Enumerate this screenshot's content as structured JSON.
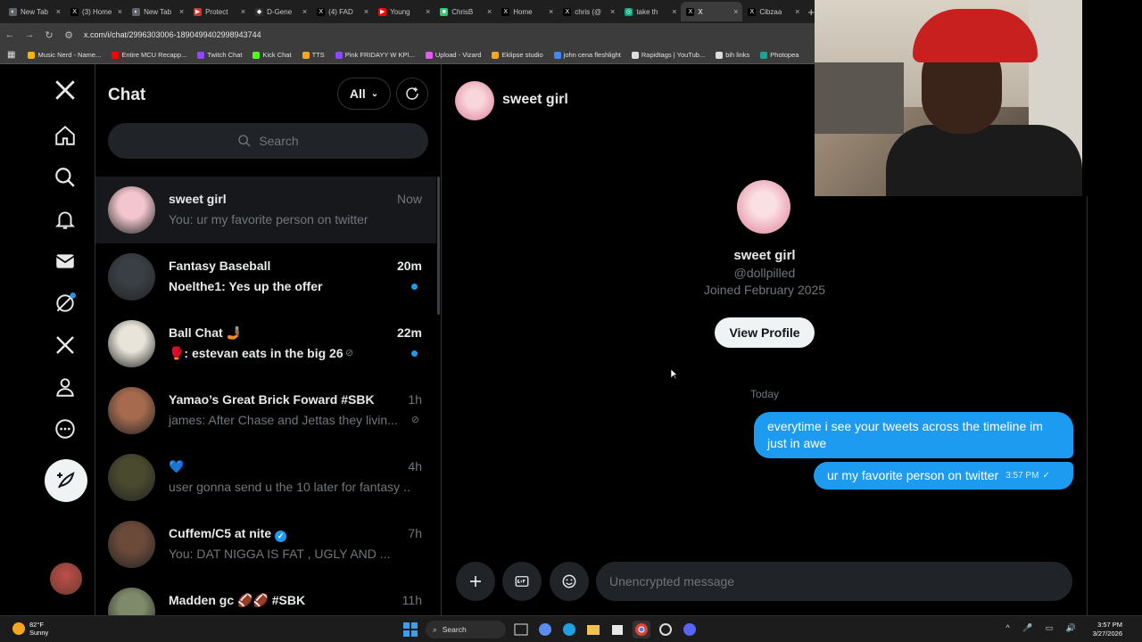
{
  "browser": {
    "tabs": [
      {
        "title": "New Tab",
        "color": "#5f6368",
        "glyph": "◐"
      },
      {
        "title": "(3) Home",
        "color": "#000000",
        "glyph": "X"
      },
      {
        "title": "New Tab",
        "color": "#5f6368",
        "glyph": "◐"
      },
      {
        "title": "Protect",
        "color": "#d93025",
        "glyph": "▶"
      },
      {
        "title": "D-Gene",
        "color": "#333333",
        "glyph": "◆"
      },
      {
        "title": "(4) FAD",
        "color": "#000000",
        "glyph": "X"
      },
      {
        "title": "Young",
        "color": "#ff0000",
        "glyph": "▶"
      },
      {
        "title": "ChrisB",
        "color": "#2ecc71",
        "glyph": "■"
      },
      {
        "title": "Home",
        "color": "#000000",
        "glyph": "X"
      },
      {
        "title": "chris (@",
        "color": "#000000",
        "glyph": "X"
      },
      {
        "title": "take th",
        "color": "#10a37f",
        "glyph": "◎"
      },
      {
        "title": "X",
        "color": "#000000",
        "glyph": "X",
        "active": true
      },
      {
        "title": "Cibzaa",
        "color": "#000000",
        "glyph": "X"
      }
    ],
    "url": "x.com/i/chat/2996303006-1890499402998943744",
    "bookmarks": [
      {
        "label": "Music Nerd - Name...",
        "color": "#f4b400"
      },
      {
        "label": "Entire MCU Recapp...",
        "color": "#ff0000"
      },
      {
        "label": "Twitch Chat",
        "color": "#9146ff"
      },
      {
        "label": "Kick Chat",
        "color": "#53fc18"
      },
      {
        "label": "TTS",
        "color": "#f5a623"
      },
      {
        "label": "Pink FRIDAYY W KPI...",
        "color": "#9146ff"
      },
      {
        "label": "Upload - Vizard",
        "color": "#e05cf2"
      },
      {
        "label": "Eklipse studio",
        "color": "#f5a623"
      },
      {
        "label": "john cena fleshlight",
        "color": "#4285f4"
      },
      {
        "label": "Rapidtags | YouTub...",
        "color": "#dddddd"
      },
      {
        "label": "bih links",
        "color": "#dddddd"
      },
      {
        "label": "Photopea",
        "color": "#18a497"
      }
    ]
  },
  "chat_list": {
    "title": "Chat",
    "filter_label": "All",
    "search_placeholder": "Search",
    "conversations": [
      {
        "name": "sweet girl",
        "preview": "You: ur my favorite person on twitter",
        "time": "Now",
        "unread": false,
        "muted": false,
        "selected": true,
        "avatar_color": "#f3c6cf"
      },
      {
        "name": "Fantasy Baseball",
        "preview": "Noelthe1: Yes up the offer",
        "time": "20m",
        "unread": true,
        "muted": false,
        "selected": false,
        "avatar_color": "#3a3f45"
      },
      {
        "name": "Ball Chat 🤳🏾",
        "preview": "🥊: estevan eats in the big 26",
        "time": "22m",
        "unread": true,
        "muted": true,
        "selected": false,
        "avatar_color": "#e8e4da"
      },
      {
        "name": "Yamao’s Great Brick Foward #SBK",
        "preview": "james: After Chase and Jettas they livin...",
        "time": "1h",
        "unread": false,
        "muted": true,
        "selected": false,
        "avatar_color": "#a66b4f"
      },
      {
        "name": "💙",
        "preview": "user gonna send u the 10 later for fantasy ...",
        "time": "4h",
        "unread": false,
        "muted": false,
        "selected": false,
        "avatar_color": "#4a4a2e"
      },
      {
        "name": "Cuffem/C5 at nite",
        "preview": "You: DAT NIGGA IS FAT , UGLY AND ...",
        "time": "7h",
        "unread": false,
        "muted": false,
        "selected": false,
        "verified": true,
        "avatar_color": "#6b4a3a"
      },
      {
        "name": "Madden gc 🏈🏈 #SBK",
        "preview": "",
        "time": "11h",
        "unread": false,
        "muted": false,
        "selected": false,
        "avatar_color": "#7f8a6a"
      }
    ]
  },
  "conversation": {
    "header_name": "sweet girl",
    "profile": {
      "name": "sweet girl",
      "handle": "@dollpilled",
      "joined": "Joined February 2025",
      "view_profile_label": "View Profile"
    },
    "day_divider": "Today",
    "messages": [
      {
        "text": "everytime i see your tweets across the timeline im just in awe",
        "from_me": true
      },
      {
        "text": "ur my favorite person on twitter",
        "from_me": true,
        "time": "3:57 PM"
      }
    ],
    "composer_placeholder": "Unencrypted message"
  },
  "taskbar": {
    "weather_temp": "82°F",
    "weather_desc": "Sunny",
    "search_label": "Search",
    "time": "3:57 PM",
    "date": "3/27/2026"
  },
  "colors": {
    "accent": "#1d9bf0",
    "background": "#000000",
    "muted_text": "#71767b"
  }
}
